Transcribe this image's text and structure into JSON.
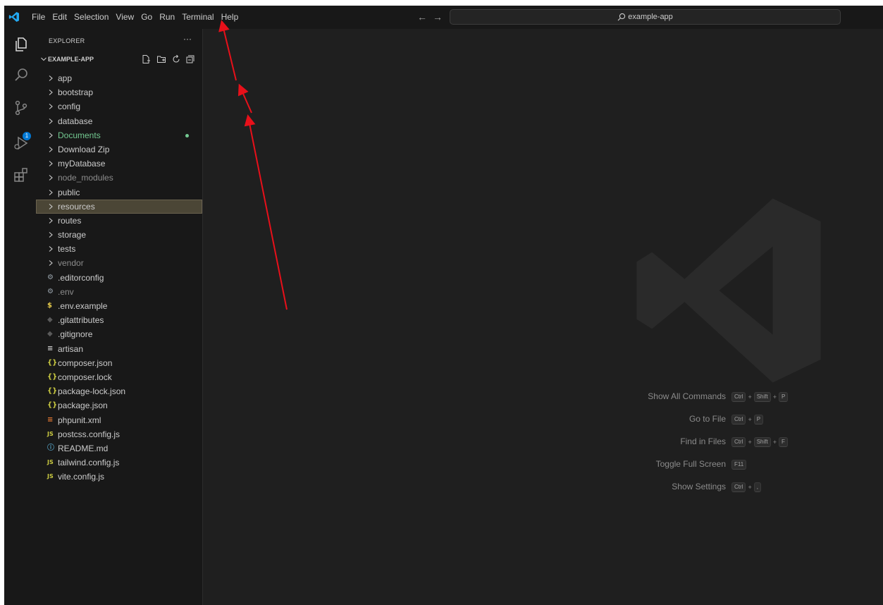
{
  "menu": [
    "File",
    "Edit",
    "Selection",
    "View",
    "Go",
    "Run",
    "Terminal",
    "Help"
  ],
  "search": {
    "text": "example-app"
  },
  "nav": {
    "back": "←",
    "forward": "→"
  },
  "activity": {
    "scm_badge": "1"
  },
  "sidebar": {
    "title": "EXPLORER",
    "more": "···",
    "folder": "EXAMPLE-APP",
    "items": [
      {
        "label": "app",
        "type": "folder",
        "color": "#cccccc"
      },
      {
        "label": "bootstrap",
        "type": "folder",
        "color": "#cccccc"
      },
      {
        "label": "config",
        "type": "folder",
        "color": "#cccccc"
      },
      {
        "label": "database",
        "type": "folder",
        "color": "#cccccc"
      },
      {
        "label": "Documents",
        "type": "folder",
        "color": "#73c991",
        "dot": true
      },
      {
        "label": "Download Zip",
        "type": "folder",
        "color": "#cccccc"
      },
      {
        "label": "myDatabase",
        "type": "folder",
        "color": "#cccccc"
      },
      {
        "label": "node_modules",
        "type": "folder",
        "color": "#8c8c8c"
      },
      {
        "label": "public",
        "type": "folder",
        "color": "#cccccc"
      },
      {
        "label": "resources",
        "type": "folder",
        "color": "#cccccc",
        "selected": true
      },
      {
        "label": "routes",
        "type": "folder",
        "color": "#cccccc"
      },
      {
        "label": "storage",
        "type": "folder",
        "color": "#cccccc"
      },
      {
        "label": "tests",
        "type": "folder",
        "color": "#cccccc"
      },
      {
        "label": "vendor",
        "type": "folder",
        "color": "#8c8c8c"
      },
      {
        "label": ".editorconfig",
        "type": "file",
        "icon": "gear-icon",
        "glyph": "⚙",
        "icon_color": "#9aa4ad",
        "color": "#cccccc"
      },
      {
        "label": ".env",
        "type": "file",
        "icon": "gear-icon",
        "glyph": "⚙",
        "icon_color": "#9aa4ad",
        "color": "#8c8c8c"
      },
      {
        "label": ".env.example",
        "type": "file",
        "icon": "dollar-icon",
        "glyph": "$",
        "icon_color": "#e3c84a",
        "color": "#cccccc"
      },
      {
        "label": ".gitattributes",
        "type": "file",
        "icon": "git-diamond-icon",
        "glyph": "◆",
        "icon_color": "#5a5a5a",
        "color": "#cccccc"
      },
      {
        "label": ".gitignore",
        "type": "file",
        "icon": "git-diamond-icon",
        "glyph": "◆",
        "icon_color": "#5a5a5a",
        "color": "#cccccc"
      },
      {
        "label": "artisan",
        "type": "file",
        "icon": "lines-icon",
        "glyph": "≡",
        "icon_color": "#cccccc",
        "color": "#cccccc"
      },
      {
        "label": "composer.json",
        "type": "file",
        "icon": "json-braces-icon",
        "glyph": "{}",
        "icon_color": "#cbcb41",
        "color": "#cccccc"
      },
      {
        "label": "composer.lock",
        "type": "file",
        "icon": "json-braces-icon",
        "glyph": "{}",
        "icon_color": "#cbcb41",
        "color": "#cccccc"
      },
      {
        "label": "package-lock.json",
        "type": "file",
        "icon": "json-braces-icon",
        "glyph": "{}",
        "icon_color": "#cbcb41",
        "color": "#cccccc"
      },
      {
        "label": "package.json",
        "type": "file",
        "icon": "json-braces-icon",
        "glyph": "{}",
        "icon_color": "#cbcb41",
        "color": "#cccccc"
      },
      {
        "label": "phpunit.xml",
        "type": "file",
        "icon": "rss-icon",
        "glyph": "≡",
        "icon_color": "#e37933",
        "color": "#cccccc"
      },
      {
        "label": "postcss.config.js",
        "type": "file",
        "icon": "js-icon",
        "glyph": "JS",
        "icon_color": "#cbcb41",
        "color": "#cccccc"
      },
      {
        "label": "README.md",
        "type": "file",
        "icon": "info-icon",
        "glyph": "ⓘ",
        "icon_color": "#519aba",
        "color": "#cccccc"
      },
      {
        "label": "tailwind.config.js",
        "type": "file",
        "icon": "js-icon",
        "glyph": "JS",
        "icon_color": "#cbcb41",
        "color": "#cccccc"
      },
      {
        "label": "vite.config.js",
        "type": "file",
        "icon": "js-icon",
        "glyph": "JS",
        "icon_color": "#cbcb41",
        "color": "#cccccc"
      }
    ]
  },
  "shortcuts": [
    {
      "label": "Show All Commands",
      "keys": [
        "Ctrl",
        "Shift",
        "P"
      ]
    },
    {
      "label": "Go to File",
      "keys": [
        "Ctrl",
        "P"
      ]
    },
    {
      "label": "Find in Files",
      "keys": [
        "Ctrl",
        "Shift",
        "F"
      ]
    },
    {
      "label": "Toggle Full Screen",
      "keys": [
        "F11"
      ]
    },
    {
      "label": "Show Settings",
      "keys": [
        "Ctrl",
        ","
      ]
    }
  ],
  "colors": {
    "accent": "#0078d4",
    "annotation": "#e8101a",
    "git_added": "#73c991"
  }
}
